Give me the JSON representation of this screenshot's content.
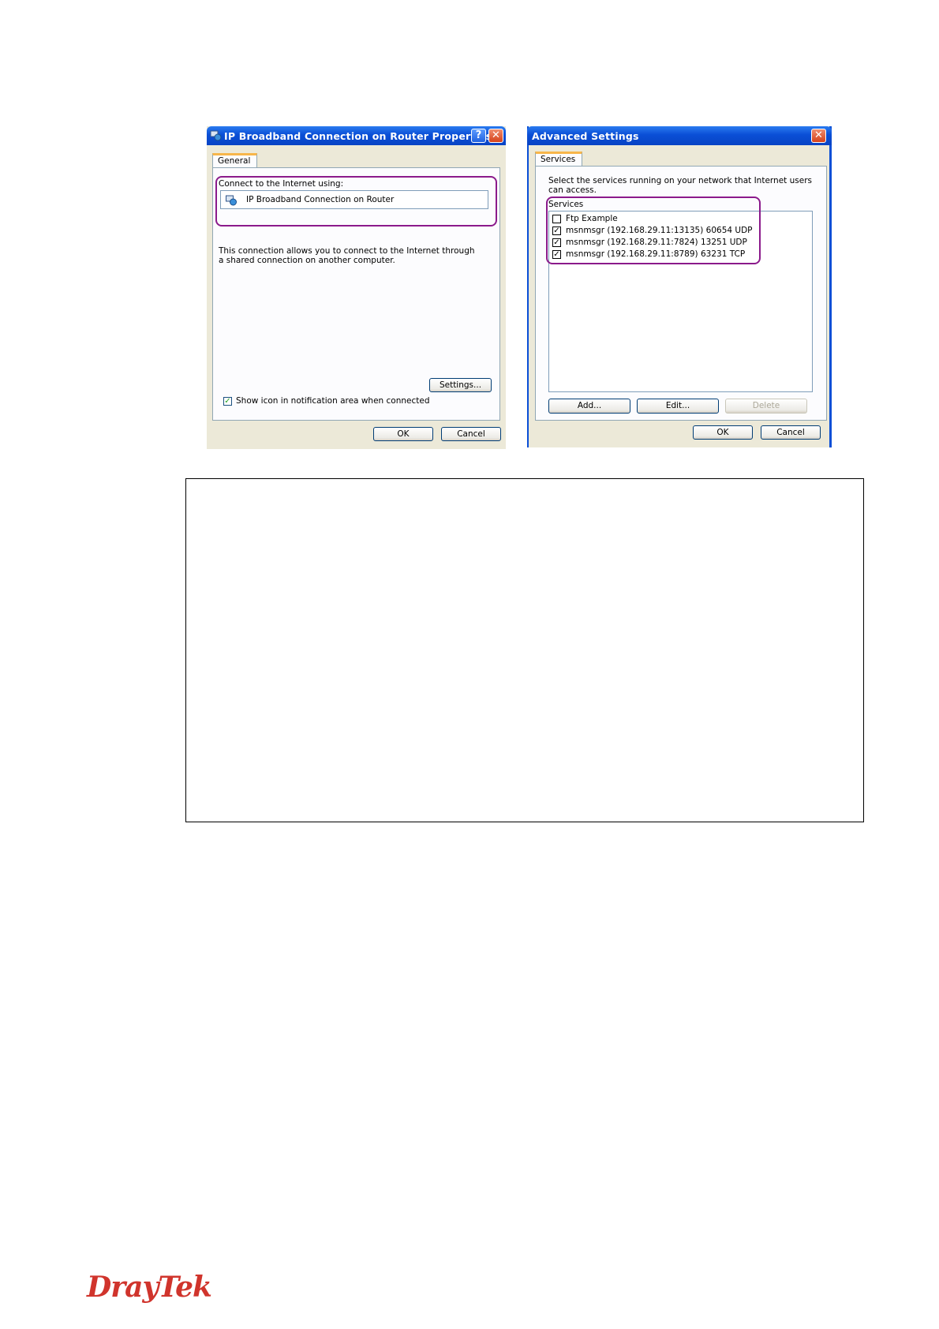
{
  "dialog1": {
    "title": "IP Broadband Connection on Router Properties",
    "tab": "General",
    "connect_label": "Connect to the Internet using:",
    "connection_name": "IP Broadband Connection on Router",
    "description": "This connection allows you to connect to the Internet through a shared connection on another computer.",
    "settings_button": "Settings...",
    "show_icon_label": "Show icon in notification area when connected",
    "show_icon_checked": true,
    "ok_button": "OK",
    "cancel_button": "Cancel",
    "help_glyph": "?",
    "close_glyph": "✕"
  },
  "dialog2": {
    "title": "Advanced Settings",
    "tab": "Services",
    "instructions": "Select the services running on your network that Internet users can access.",
    "services_label": "Services",
    "services": [
      {
        "label": "Ftp Example",
        "checked": false
      },
      {
        "label": "msnmsgr (192.168.29.11:13135) 60654 UDP",
        "checked": true
      },
      {
        "label": "msnmsgr (192.168.29.11:7824) 13251 UDP",
        "checked": true
      },
      {
        "label": "msnmsgr (192.168.29.11:8789) 63231 TCP",
        "checked": true
      }
    ],
    "add_button": "Add...",
    "edit_button": "Edit...",
    "delete_button": "Delete",
    "ok_button": "OK",
    "cancel_button": "Cancel",
    "close_glyph": "✕"
  },
  "footer": {
    "logo_text": "DrayTek",
    "brand_color": "#d0342c"
  },
  "icons": {
    "network": "network-connection-icon",
    "check": "✓"
  }
}
